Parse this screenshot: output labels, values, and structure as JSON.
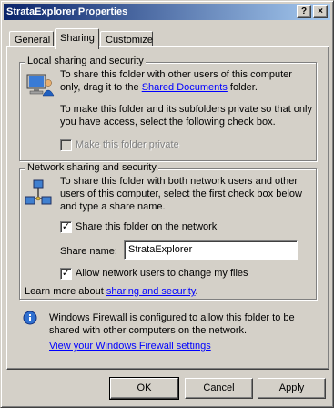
{
  "window": {
    "title": "StrataExplorer Properties",
    "help_label": "?",
    "close_label": "×"
  },
  "tabs": [
    {
      "label": "General",
      "active": false
    },
    {
      "label": "Sharing",
      "active": true
    },
    {
      "label": "Customize",
      "active": false
    }
  ],
  "local": {
    "title": "Local sharing and security",
    "text1_prefix": "To share this folder with other users of this computer only, drag it to the ",
    "text1_link": "Shared Documents",
    "text1_suffix": " folder.",
    "text2": "To make this folder and its subfolders private so that only you have access, select the following check box.",
    "private_label": "Make this folder private",
    "private_checked": false,
    "private_enabled": false
  },
  "network": {
    "title": "Network sharing and security",
    "text": "To share this folder with both network users and other users of this computer, select the first check box below and type a share name.",
    "share_label": "Share this folder on the network",
    "share_checked": true,
    "share_name_label": "Share name:",
    "share_name_value": "StrataExplorer",
    "allow_label": "Allow network users to change my files",
    "allow_checked": true,
    "learn_prefix": "Learn more about ",
    "learn_link": "sharing and security",
    "learn_suffix": "."
  },
  "firewall": {
    "text": "Windows Firewall is configured to allow this folder to be shared with other computers on the network.",
    "link": "View your Windows Firewall settings"
  },
  "buttons": {
    "ok": "OK",
    "cancel": "Cancel",
    "apply": "Apply"
  },
  "colors": {
    "titlebar_start": "#0a246a",
    "titlebar_end": "#a6caf0",
    "face": "#d4d0c8",
    "link": "#0000ff"
  }
}
